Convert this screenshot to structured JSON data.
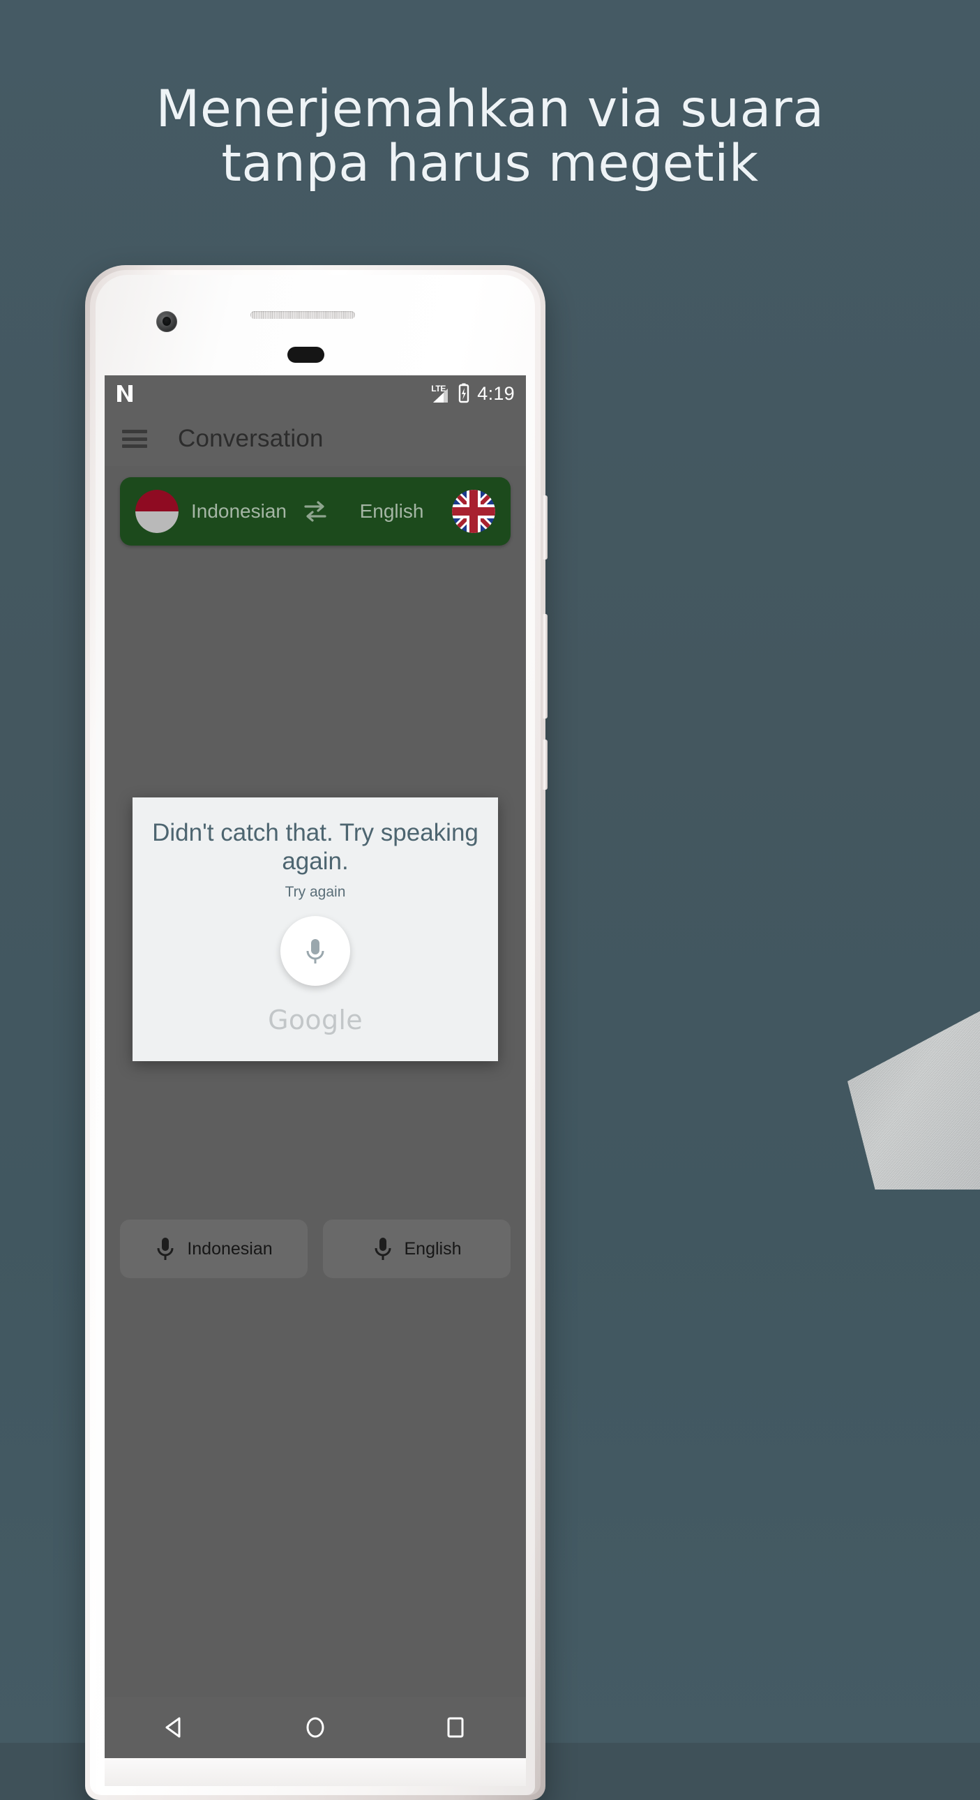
{
  "background": {
    "top_color": "#455a64",
    "bottom_color": "#455b64",
    "wedge_color": "#c3c6c7"
  },
  "headline": {
    "line1": "Menerjemahkan via suara",
    "line2": "tanpa harus megetik",
    "color": "#eef3f6"
  },
  "phone": {
    "device_icons": {
      "front_camera": "camera-icon",
      "earpiece": "speaker-grille-icon",
      "sensor": "proximity-sensor-icon"
    }
  },
  "screen": {
    "statusbar": {
      "os_icon": "android-nougat-n-icon",
      "network_label": "LTE",
      "signal_icon": "signal-bars-icon",
      "battery_icon": "battery-charging-icon",
      "time": "4:19"
    },
    "appbar": {
      "menu_icon": "hamburger-menu-icon",
      "title": "Conversation"
    },
    "language_bar": {
      "background_color": "#1c4a1c",
      "source": {
        "flag_icon": "indonesia-flag-icon",
        "label": "Indonesian"
      },
      "swap_icon": "swap-arrows-icon",
      "target": {
        "label": "English",
        "flag_icon": "united-kingdom-flag-icon"
      }
    },
    "card": {
      "title": "Didn't catch that. Try speaking again.",
      "subtitle": "Try again",
      "mic_icon": "microphone-icon",
      "brand": "Google",
      "background_color": "#eff1f2",
      "title_color": "#4d6570"
    },
    "bottom_buttons": [
      {
        "mic_icon": "microphone-icon",
        "label": "Indonesian"
      },
      {
        "mic_icon": "microphone-icon",
        "label": "English"
      }
    ],
    "navbar": {
      "back_icon": "back-triangle-icon",
      "home_icon": "home-circle-icon",
      "recents_icon": "recents-square-icon"
    }
  }
}
